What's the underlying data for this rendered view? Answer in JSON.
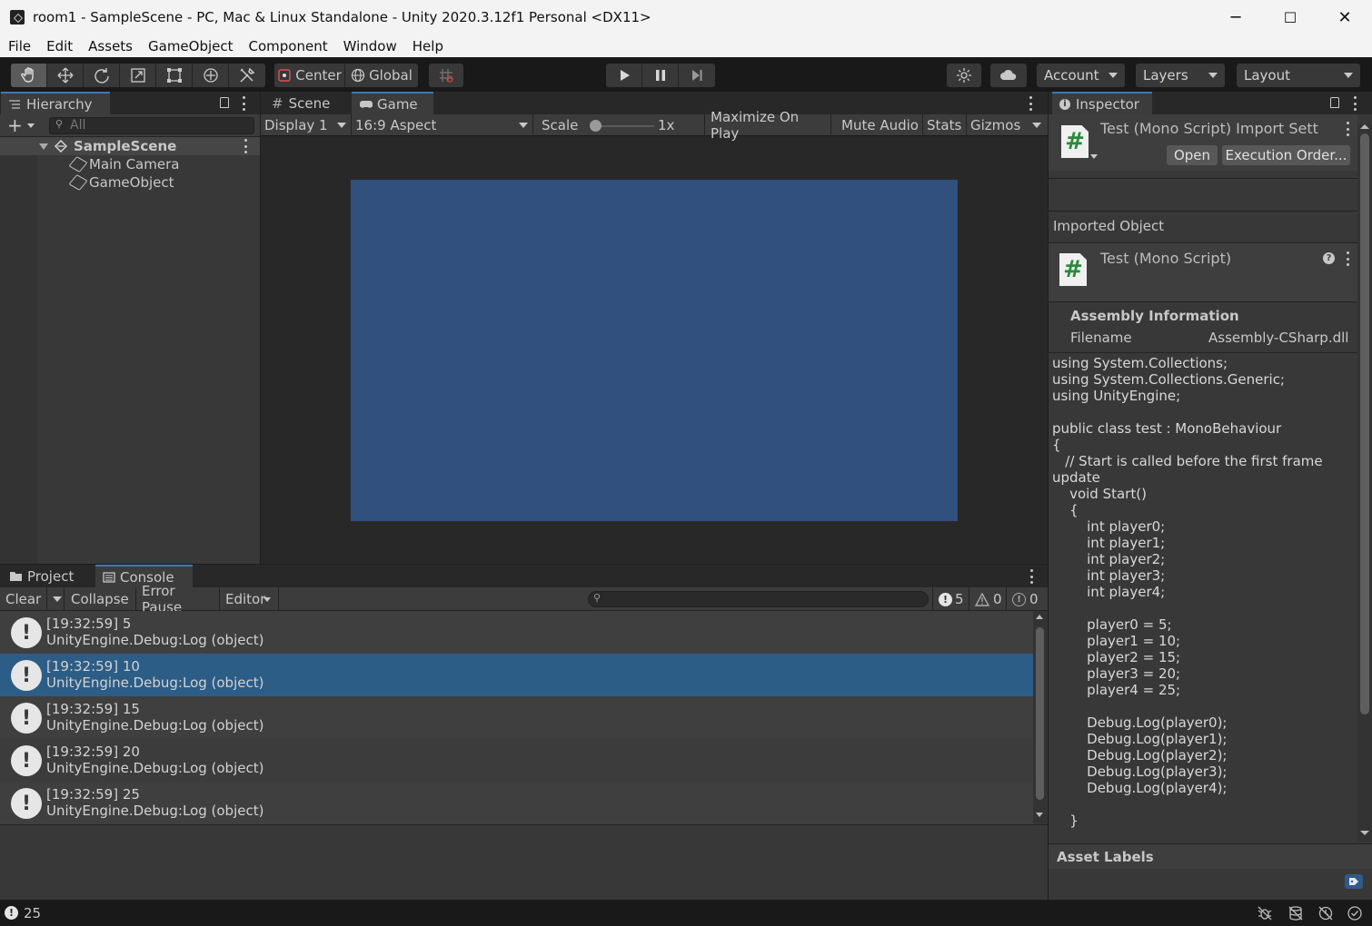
{
  "window": {
    "title": "room1 - SampleScene - PC, Mac & Linux Standalone - Unity 2020.3.12f1 Personal <DX11>",
    "minimize": "─",
    "maximize": "☐",
    "close": "✕"
  },
  "menu": [
    "File",
    "Edit",
    "Assets",
    "GameObject",
    "Component",
    "Window",
    "Help"
  ],
  "toolbar": {
    "tools": [
      "hand-tool",
      "move-tool",
      "rotate-tool",
      "scale-tool",
      "rect-tool",
      "transform-tool",
      "custom-tool"
    ],
    "pivot": "Center",
    "space": "Global",
    "account": "Account",
    "layers": "Layers",
    "layout": "Layout"
  },
  "hierarchy": {
    "tab": "Hierarchy",
    "search_placeholder": "All",
    "scene": "SampleScene",
    "objects": [
      "Main Camera",
      "GameObject"
    ]
  },
  "game": {
    "tabs": [
      "Scene",
      "Game"
    ],
    "display": "Display 1",
    "aspect": "16:9 Aspect",
    "scale_label": "Scale",
    "scale_value": "1x",
    "maximize": "Maximize On Play",
    "mute": "Mute Audio",
    "stats": "Stats",
    "gizmos": "Gizmos",
    "viewport_color": "#31507d"
  },
  "console": {
    "tabs": [
      "Project",
      "Console"
    ],
    "clear": "Clear",
    "collapse": "Collapse",
    "error_pause": "Error Pause",
    "editor": "Editor",
    "log_count": "5",
    "warn_count": "0",
    "error_count": "0",
    "entries": [
      {
        "line1": "[19:32:59] 5",
        "line2": "UnityEngine.Debug:Log (object)"
      },
      {
        "line1": "[19:32:59] 10",
        "line2": "UnityEngine.Debug:Log (object)"
      },
      {
        "line1": "[19:32:59] 15",
        "line2": "UnityEngine.Debug:Log (object)"
      },
      {
        "line1": "[19:32:59] 20",
        "line2": "UnityEngine.Debug:Log (object)"
      },
      {
        "line1": "[19:32:59] 25",
        "line2": "UnityEngine.Debug:Log (object)"
      }
    ],
    "selected_index": 1
  },
  "inspector": {
    "tab": "Inspector",
    "header_title": "Test (Mono Script) Import Setti",
    "open_button": "Open",
    "exec_button": "Execution Order...",
    "imported_object": "Imported Object",
    "script_title": "Test (Mono Script)",
    "assembly_info": "Assembly Information",
    "filename_label": "Filename",
    "filename_value": "Assembly-CSharp.dll",
    "code": "using System.Collections;\nusing System.Collections.Generic;\nusing UnityEngine;\n\npublic class test : MonoBehaviour\n{\n   // Start is called before the first frame\nupdate\n    void Start()\n    {\n        int player0;\n        int player1;\n        int player2;\n        int player3;\n        int player4;\n\n        player0 = 5;\n        player1 = 10;\n        player2 = 15;\n        player3 = 20;\n        player4 = 25;\n\n        Debug.Log(player0);\n        Debug.Log(player1);\n        Debug.Log(player2);\n        Debug.Log(player3);\n        Debug.Log(player4);\n\n    }",
    "asset_labels": "Asset Labels"
  },
  "status": {
    "message": "25"
  }
}
